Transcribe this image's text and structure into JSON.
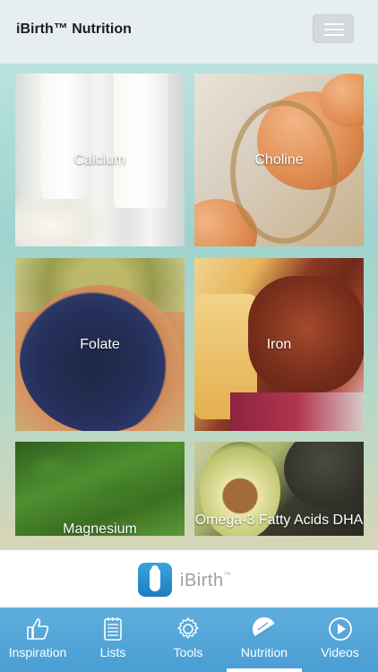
{
  "header": {
    "title": "iBirth™ Nutrition",
    "menu_icon": "hamburger-menu-icon"
  },
  "tiles": [
    {
      "label": "Calcium"
    },
    {
      "label": "Choline"
    },
    {
      "label": "Folate"
    },
    {
      "label": "Iron"
    },
    {
      "label": "Magnesium"
    },
    {
      "label": "Omega-3 Fatty Acids DHA"
    }
  ],
  "brand": {
    "name": "iBirth",
    "mark": "™"
  },
  "tabs": [
    {
      "label": "Inspiration",
      "icon": "thumbs-up-icon"
    },
    {
      "label": "Lists",
      "icon": "notepad-icon"
    },
    {
      "label": "Tools",
      "icon": "gear-icon"
    },
    {
      "label": "Nutrition",
      "icon": "citrus-slice-icon",
      "active": true
    },
    {
      "label": "Videos",
      "icon": "play-circle-icon"
    }
  ],
  "colors": {
    "accent": "#4a9ed3",
    "header_bg": "#e6eef1"
  }
}
